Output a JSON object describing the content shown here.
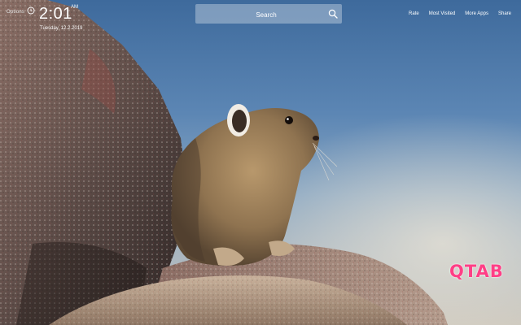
{
  "topbar": {
    "options_label": "Options",
    "time": "2:01",
    "am_pm": "AM",
    "date": "Tuesday, 12.2.2019"
  },
  "search": {
    "placeholder": "Search"
  },
  "nav": {
    "items": [
      "Rate",
      "Most Visited",
      "More Apps",
      "Share"
    ]
  },
  "logo": {
    "text": "QTAB"
  },
  "colors": {
    "logo": "#ff3f86",
    "sky": "#4a77a8"
  },
  "background": {
    "subject": "pika-on-rock-photo"
  }
}
